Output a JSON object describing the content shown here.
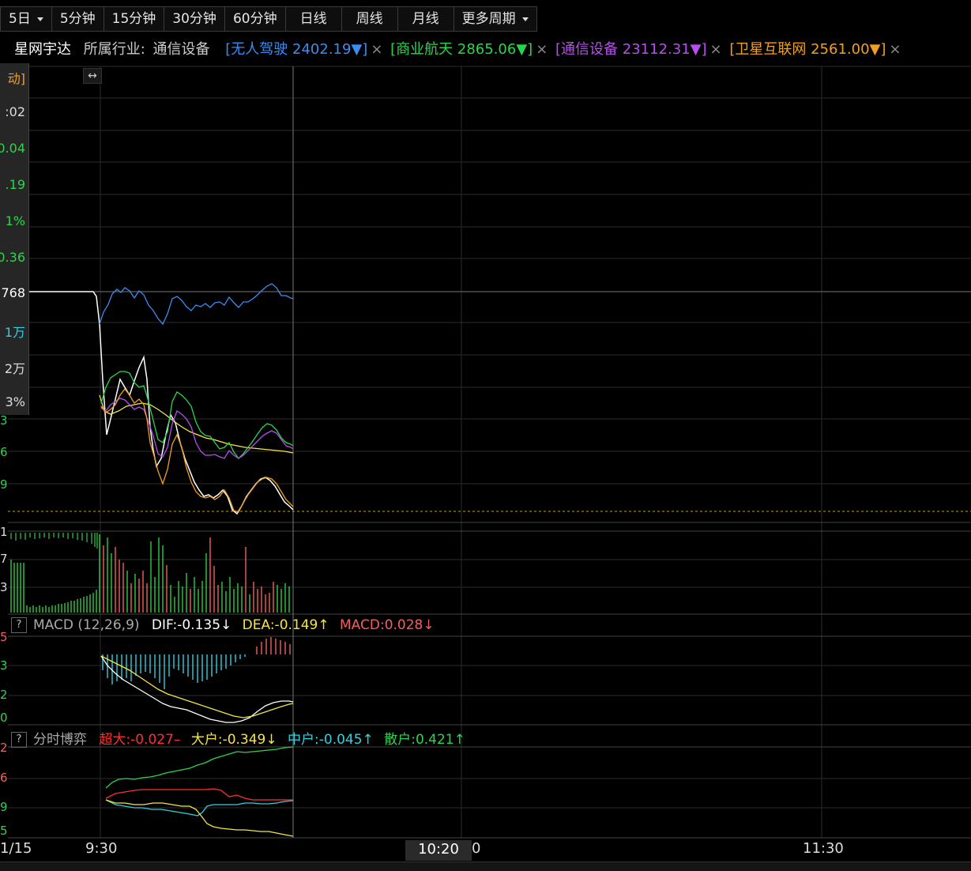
{
  "tabs": [
    {
      "label": "5日",
      "dropdown": true
    },
    {
      "label": "5分钟"
    },
    {
      "label": "15分钟"
    },
    {
      "label": "30分钟"
    },
    {
      "label": "60分钟"
    },
    {
      "label": "日线"
    },
    {
      "label": "周线"
    },
    {
      "label": "月线"
    },
    {
      "label": "更多周期",
      "dropdown": true
    }
  ],
  "info": {
    "stock_name": "星网宇达",
    "industry_label": "所属行业:",
    "industry": "通信设备",
    "sectors": [
      {
        "text": "[无人驾驶 2402.19▼]",
        "color": "#3b8df0"
      },
      {
        "text": "[商业航天 2865.06▼]",
        "color": "#29d64a"
      },
      {
        "text": "[通信设备 23112.31▼]",
        "color": "#b84df0"
      },
      {
        "text": "[卫星互联网 2561.00▼]",
        "color": "#f0a020"
      }
    ],
    "close_glyph": "×"
  },
  "left_panel": [
    "动]",
    ":02",
    "0.04",
    ".19",
    "1%",
    "0.36",
    "768",
    "1万",
    "2万",
    "3%"
  ],
  "left_axis_main": [
    "3",
    "6",
    "9"
  ],
  "left_axis_volume": [
    "1",
    "7",
    "3"
  ],
  "left_axis_macd": [
    "5",
    "3",
    "2",
    "0"
  ],
  "left_axis_flow": [
    "2",
    "6",
    "9",
    "5"
  ],
  "expand_glyph": "↔",
  "macd": {
    "label": "MACD (12,26,9)",
    "dif": "DIF:-0.135↓",
    "dea": "DEA:-0.149↑",
    "macd": "MACD:0.028↓"
  },
  "flow": {
    "label": "分时博弈",
    "super": "超大:-0.027–",
    "large": "大户:-0.349↓",
    "medium": "中户:-0.045↑",
    "retail": "散户:0.421↑"
  },
  "time_axis": {
    "date": "1/15",
    "t1": "9:30",
    "t2": "10:20",
    "t2_suffix": "0",
    "t3": "11:30"
  },
  "colors": {
    "white_line": "#ffffff",
    "yellow_line": "#f5e642",
    "blue_line": "#3b8df0",
    "green_line": "#29d64a",
    "purple_line": "#b84df0",
    "orange_line": "#f0a020",
    "down_bar": "#2ecc40",
    "up_bar": "#f06060",
    "macd_neg": "#2fd0e0"
  }
}
